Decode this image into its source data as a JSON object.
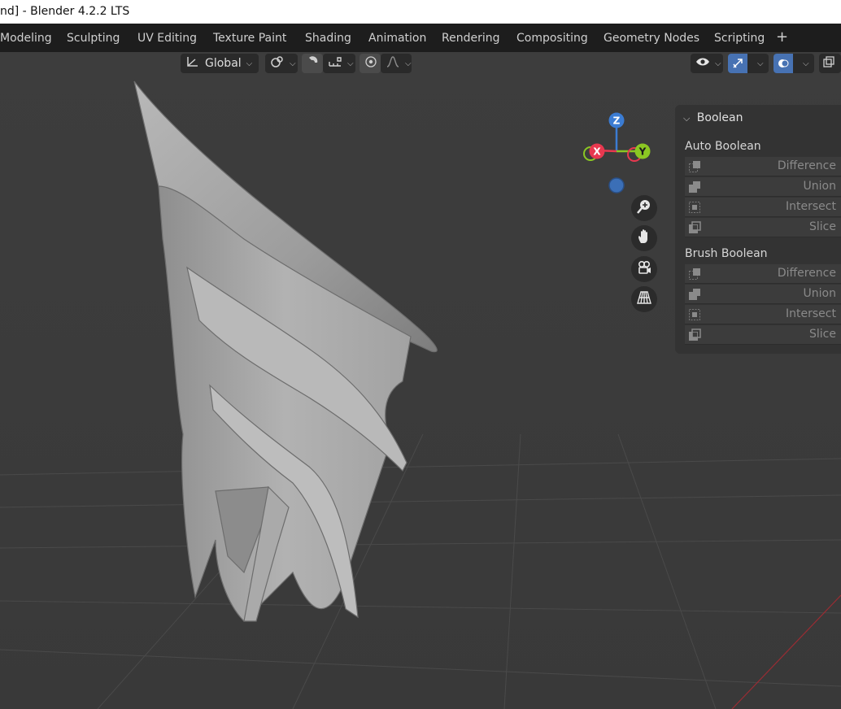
{
  "window": {
    "title": "nd] - Blender 4.2.2 LTS"
  },
  "workspace_tabs": [
    {
      "label": "Modeling"
    },
    {
      "label": "Sculpting"
    },
    {
      "label": "UV Editing"
    },
    {
      "label": "Texture Paint"
    },
    {
      "label": "Shading"
    },
    {
      "label": "Animation"
    },
    {
      "label": "Rendering"
    },
    {
      "label": "Compositing"
    },
    {
      "label": "Geometry Nodes"
    },
    {
      "label": "Scripting"
    }
  ],
  "workspace_add": "+",
  "header": {
    "transform_orientation": "Global"
  },
  "gizmo": {
    "z": "Z",
    "x": "X",
    "y": "Y"
  },
  "navigation_icons": [
    "zoom-icon",
    "hand-pan-icon",
    "camera-icon",
    "perspective-grid-icon"
  ],
  "boolean_panel": {
    "title": "Boolean",
    "auto_boolean": {
      "label": "Auto Boolean",
      "items": [
        {
          "label": "Difference"
        },
        {
          "label": "Union"
        },
        {
          "label": "Intersect"
        },
        {
          "label": "Slice"
        }
      ]
    },
    "brush_boolean": {
      "label": "Brush Boolean",
      "items": [
        {
          "label": "Difference"
        },
        {
          "label": "Union"
        },
        {
          "label": "Intersect"
        },
        {
          "label": "Slice"
        }
      ]
    }
  },
  "colors": {
    "x_axis": "#e8384f",
    "y_axis": "#8bc723",
    "z_axis": "#3b7cd3",
    "active_blue": "#4772b3"
  }
}
